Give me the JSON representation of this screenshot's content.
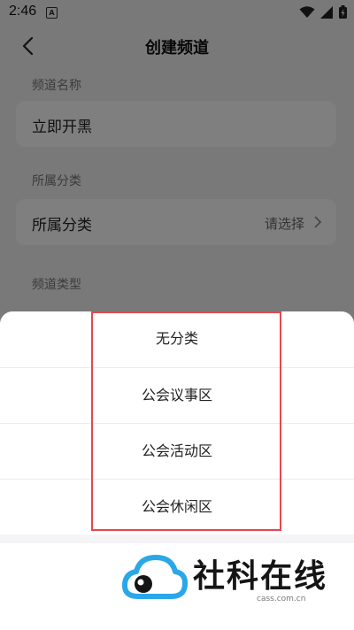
{
  "status_bar": {
    "time": "2:46",
    "notification_badge": "A"
  },
  "header": {
    "title": "创建频道"
  },
  "form": {
    "channel_name_label": "频道名称",
    "channel_name_value": "立即开黑",
    "category_label": "所属分类",
    "category_field_label": "所属分类",
    "category_field_value": "请选择",
    "channel_type_label": "频道类型"
  },
  "category_sheet": {
    "options": [
      "无分类",
      "公会议事区",
      "公会活动区",
      "公会休闲区"
    ]
  },
  "watermark": {
    "brand": "社科在线",
    "domain": "cass.com.cn"
  },
  "colors": {
    "highlight": "#e5484d",
    "logo_blue": "#2aa7e8"
  }
}
